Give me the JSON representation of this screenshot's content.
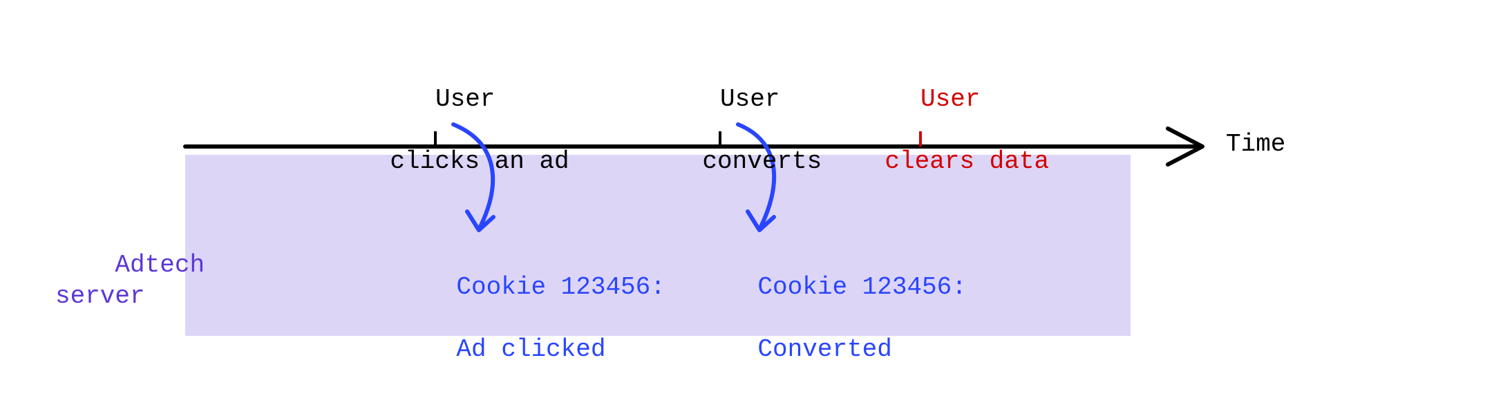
{
  "axis_label": "Time",
  "server_label": "Adtech\nserver",
  "events": {
    "click": {
      "line1": "User",
      "line2": "clicks an ad"
    },
    "convert": {
      "line1": "User",
      "line2": "converts"
    },
    "clear": {
      "line1": "User",
      "line2": "clears data"
    }
  },
  "server_notes": {
    "click": {
      "line1": "Cookie 123456:",
      "line2": "Ad clicked"
    },
    "convert": {
      "line1": "Cookie 123456:",
      "line2": "Converted"
    }
  }
}
